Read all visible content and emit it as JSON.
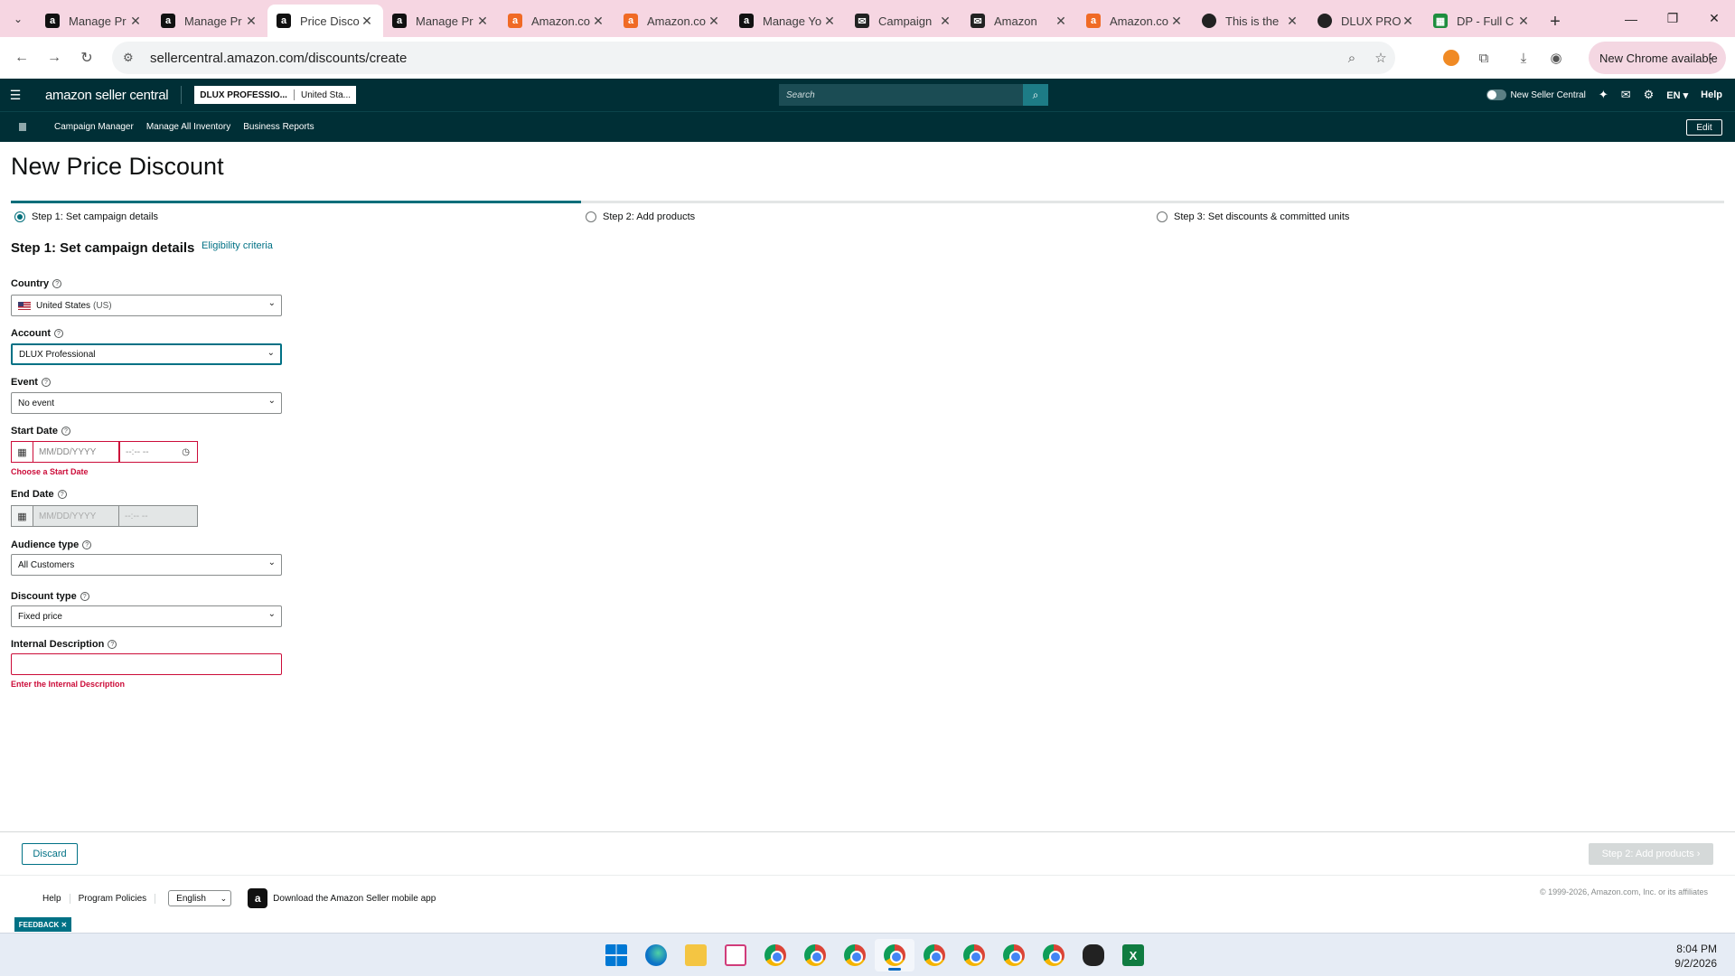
{
  "browser": {
    "tabs": [
      {
        "title": "Manage Pr",
        "favicon": "amazon-icon"
      },
      {
        "title": "Manage Pr",
        "favicon": "amazon-icon"
      },
      {
        "title": "Price Disco",
        "favicon": "amazon-icon",
        "active": true
      },
      {
        "title": "Manage Pr",
        "favicon": "amazon-icon"
      },
      {
        "title": "Amazon.co",
        "favicon": "amazon-orange-icon"
      },
      {
        "title": "Amazon.co",
        "favicon": "amazon-orange-icon"
      },
      {
        "title": "Manage Yo",
        "favicon": "amazon-icon"
      },
      {
        "title": "Campaign",
        "favicon": "mail-icon"
      },
      {
        "title": "Amazon",
        "favicon": "mail-icon"
      },
      {
        "title": "Amazon.co",
        "favicon": "amazon-orange-icon"
      },
      {
        "title": "This is the",
        "favicon": "circle-icon"
      },
      {
        "title": "DLUX PRO",
        "favicon": "circle-icon"
      },
      {
        "title": "DP - Full C",
        "favicon": "sheets-icon"
      }
    ],
    "tab_close_glyph": "✕",
    "new_tab_glyph": "+",
    "url": "sellercentral.amazon.com/discounts/create",
    "new_chrome_label": "New Chrome available"
  },
  "sc_header": {
    "logo_text": "amazon seller central",
    "account_name": "DLUX PROFESSIO...",
    "account_region": "United Sta...",
    "search_placeholder": "Search",
    "new_seller_central_label": "New Seller Central",
    "language": "EN",
    "help_label": "Help"
  },
  "sc_subnav": {
    "links": [
      "Campaign Manager",
      "Manage All Inventory",
      "Business Reports"
    ],
    "edit_label": "Edit"
  },
  "page": {
    "title": "New Price Discount",
    "progress_fraction": 0.333,
    "steps": [
      {
        "label": "Step 1: Set campaign details",
        "selected": true
      },
      {
        "label": "Step 2: Add products",
        "selected": false
      },
      {
        "label": "Step 3: Set discounts & committed units",
        "selected": false
      }
    ],
    "section_title": "Step 1: Set campaign details",
    "eligibility_link": "Eligibility criteria"
  },
  "form": {
    "country": {
      "label": "Country",
      "value": "United States",
      "value_suffix": "(US)"
    },
    "account": {
      "label": "Account",
      "value": "DLUX Professional"
    },
    "event": {
      "label": "Event",
      "value": "No event"
    },
    "start_date": {
      "label": "Start Date",
      "date_placeholder": "MM/DD/YYYY",
      "time_placeholder": "--:-- --",
      "error": "Choose a Start Date"
    },
    "end_date": {
      "label": "End Date",
      "date_placeholder": "MM/DD/YYYY",
      "time_placeholder": "--:-- --"
    },
    "audience_type": {
      "label": "Audience type",
      "value": "All Customers"
    },
    "discount_type": {
      "label": "Discount type",
      "value": "Fixed price"
    },
    "internal_description": {
      "label": "Internal Description",
      "input_value": "",
      "placeholder": "",
      "error": "Enter the Internal Description"
    }
  },
  "actions": {
    "discard_label": "Discard",
    "next_label": "Step 2: Add products"
  },
  "footer": {
    "links": [
      "Help",
      "Program Policies"
    ],
    "language_select": "English",
    "app_download": "Download the Amazon Seller mobile app",
    "copyright": "© 1999-2026, Amazon.com, Inc. or its affiliates",
    "feedback_label": "FEEDBACK"
  },
  "taskbar": {
    "time": "8:04 PM",
    "date": "9/2/2026"
  },
  "colors": {
    "header_bg": "#002f36",
    "accent_teal": "#007185",
    "progress": "#006e7a",
    "error": "#cc0c39",
    "tabstrip_bg": "#f6d6e2"
  }
}
